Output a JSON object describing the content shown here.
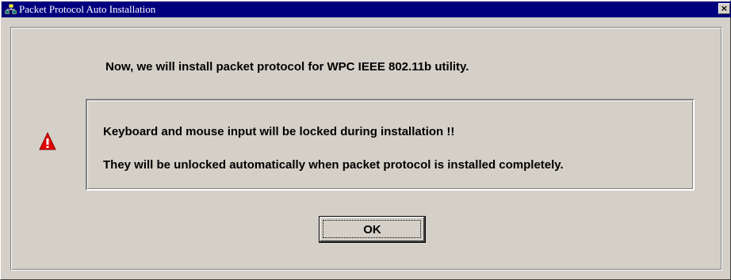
{
  "window": {
    "title": "Packet Protocol Auto Installation",
    "close_glyph": "×"
  },
  "dialog": {
    "intro": "Now, we will install packet protocol for WPC IEEE 802.11b utility.",
    "warning_line_1": "Keyboard and mouse input will be locked during installation !!",
    "warning_line_2": "They will be unlocked automatically when packet protocol is installed completely.",
    "ok_label": "OK"
  },
  "icons": {
    "app": "network-computers-icon",
    "warning": "warning-triangle-icon",
    "close": "close-icon"
  },
  "colors": {
    "titlebar": "#00007f",
    "face": "#d4d0c8",
    "warning_red": "#e00000"
  }
}
